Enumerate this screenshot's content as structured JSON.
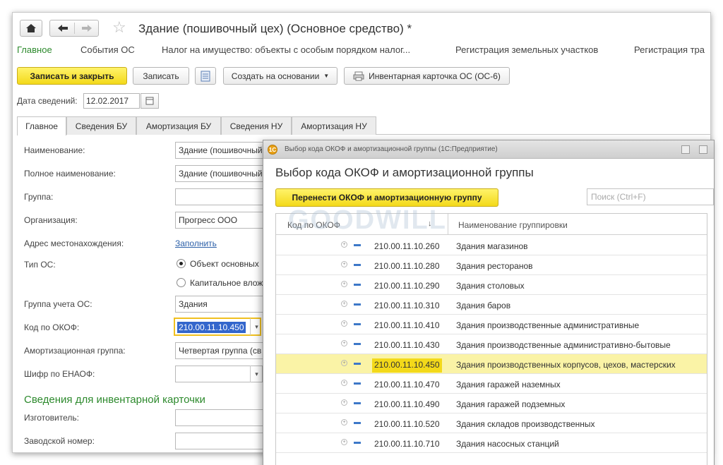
{
  "window": {
    "title": "Здание (пошивочный цех) (Основное средство) *"
  },
  "sections": [
    "Главное",
    "События ОС",
    "Налог на имущество: объекты с особым порядком налог...",
    "Регистрация земельных участков",
    "Регистрация тра"
  ],
  "toolbar": {
    "save_close": "Записать и закрыть",
    "save": "Записать",
    "create_based": "Создать на основании",
    "inventory_card": "Инвентарная карточка ОС (ОС-6)"
  },
  "date": {
    "label": "Дата сведений:",
    "value": "12.02.2017"
  },
  "tabs": [
    "Главное",
    "Сведения БУ",
    "Амортизация БУ",
    "Сведения НУ",
    "Амортизация НУ"
  ],
  "form": {
    "name_label": "Наименование:",
    "name_value": "Здание (пошивочный",
    "fullname_label": "Полное наименование:",
    "fullname_value": "Здание (пошивочный",
    "group_label": "Группа:",
    "org_label": "Организация:",
    "org_value": "Прогресс ООО",
    "address_label": "Адрес местонахождения:",
    "address_link": "Заполнить",
    "type_label": "Тип ОС:",
    "type_option1": "Объект основных",
    "type_option2": "Капитальное влож",
    "account_group_label": "Группа учета ОС:",
    "account_group_value": "Здания",
    "okof_label": "Код по ОКОФ:",
    "okof_value": "210.00.11.10.450",
    "amort_group_label": "Амортизационная группа:",
    "amort_group_value": "Четвертая группа (св",
    "enaof_label": "Шифр по ЕНАОФ:",
    "inventory_section": "Сведения для инвентарной карточки",
    "manufacturer_label": "Изготовитель:",
    "serial_label": "Заводской номер:"
  },
  "dialog": {
    "titlebar": "Выбор кода ОКОФ и амортизационной группы (1С:Предприятие)",
    "heading": "Выбор кода ОКОФ и амортизационной группы",
    "transfer_button": "Перенести ОКОФ и амортизационную группу",
    "search_placeholder": "Поиск (Ctrl+F)",
    "col_code": "Код по ОКОФ",
    "col_name": "Наименование группировки",
    "rows": [
      {
        "code": "210.00.11.10.260",
        "name": "Здания магазинов",
        "selected": false
      },
      {
        "code": "210.00.11.10.280",
        "name": "Здания ресторанов",
        "selected": false
      },
      {
        "code": "210.00.11.10.290",
        "name": "Здания столовых",
        "selected": false
      },
      {
        "code": "210.00.11.10.310",
        "name": "Здания баров",
        "selected": false
      },
      {
        "code": "210.00.11.10.410",
        "name": "Здания производственные административные",
        "selected": false
      },
      {
        "code": "210.00.11.10.430",
        "name": "Здания производственные административно-бытовые",
        "selected": false
      },
      {
        "code": "210.00.11.10.450",
        "name": "Здания производственных корпусов, цехов, мастерских",
        "selected": true
      },
      {
        "code": "210.00.11.10.470",
        "name": "Здания гаражей наземных",
        "selected": false
      },
      {
        "code": "210.00.11.10.490",
        "name": "Здания гаражей подземных",
        "selected": false
      },
      {
        "code": "210.00.11.10.520",
        "name": "Здания складов производственных",
        "selected": false
      },
      {
        "code": "210.00.11.10.710",
        "name": "Здания насосных станций",
        "selected": false
      }
    ]
  },
  "watermark": "GOODWILL",
  "colors": {
    "accent_green": "#2d8a2d",
    "highlight_yellow": "#f3d91a",
    "selected_row": "#faf3a6",
    "link_blue": "#2b5fa8"
  }
}
